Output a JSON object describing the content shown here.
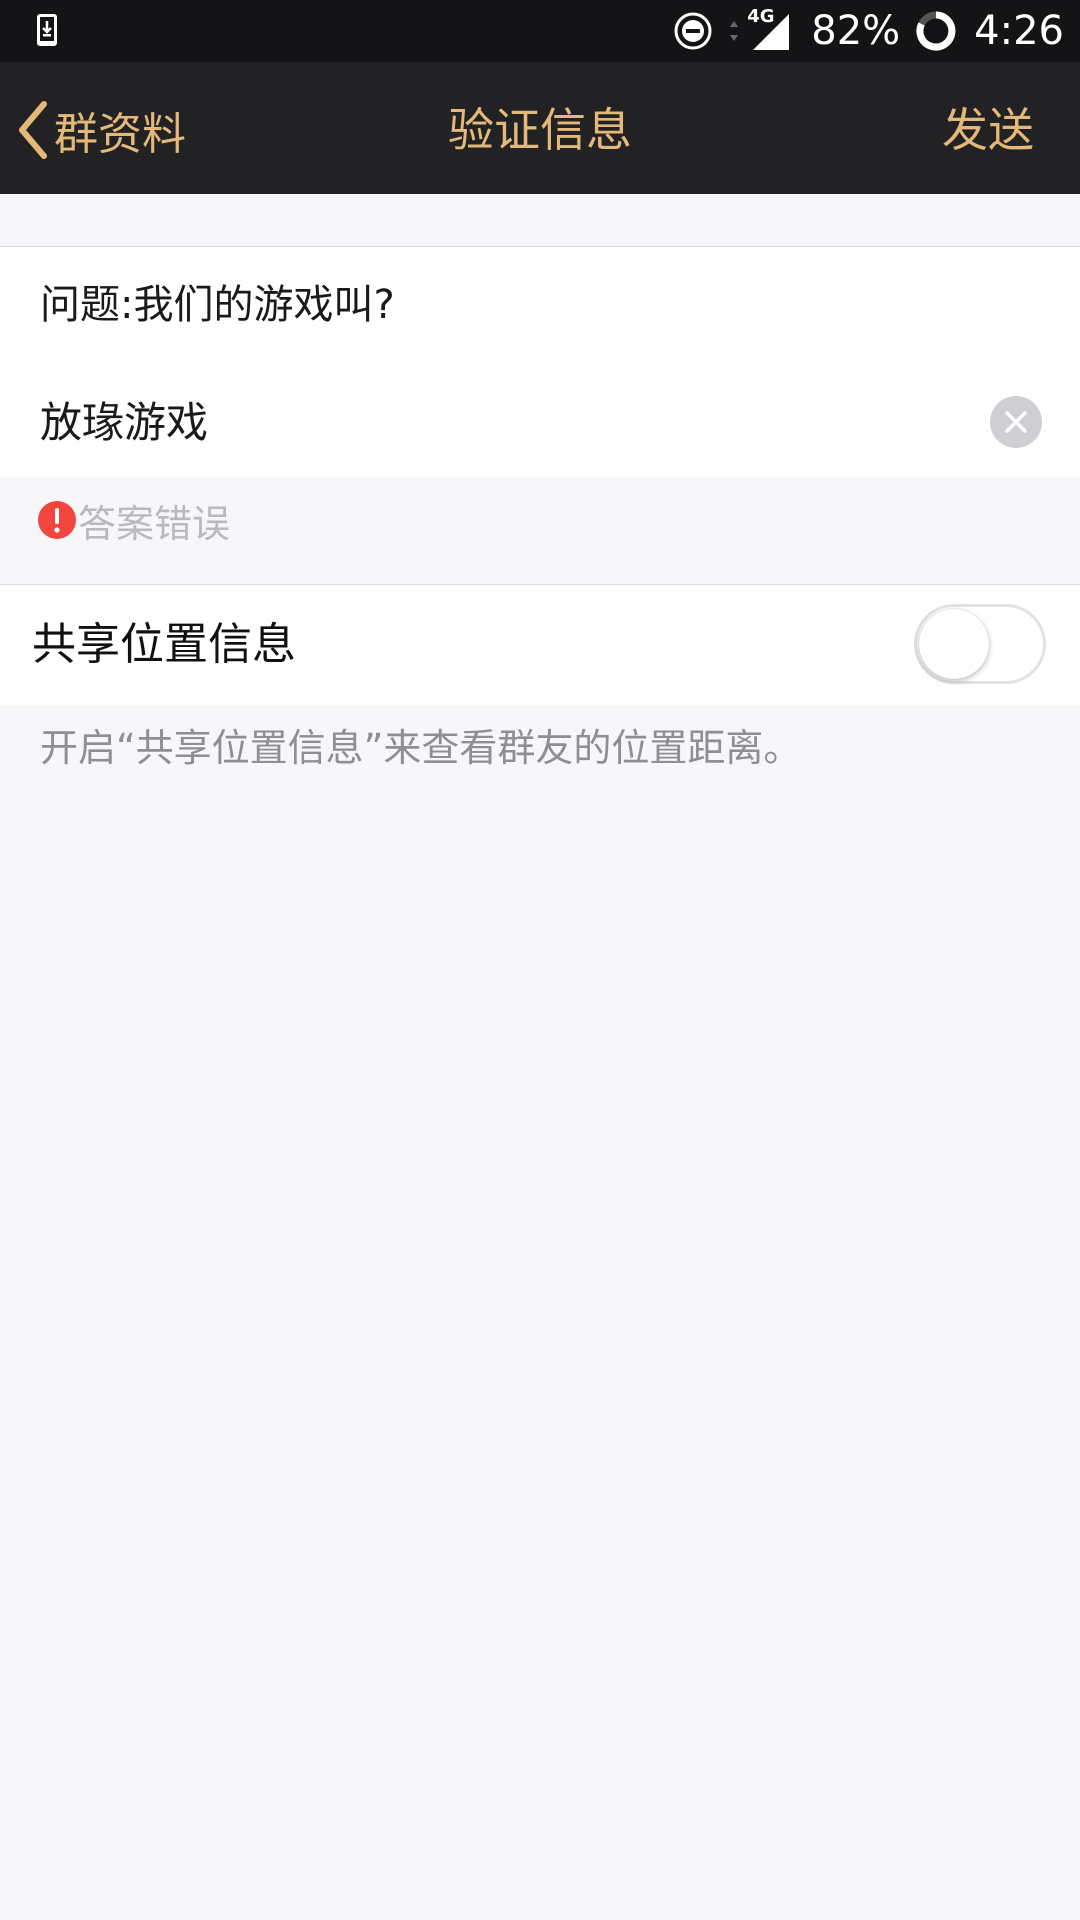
{
  "status_bar": {
    "battery": "82%",
    "time": "4:26",
    "network": "4G",
    "icons": [
      "download-icon",
      "dnd-icon",
      "data-arrows-icon",
      "signal-icon",
      "battery-ring-icon"
    ]
  },
  "nav": {
    "back_label": "群资料",
    "title": "验证信息",
    "send_label": "发送"
  },
  "form": {
    "question": "问题:我们的游戏叫?",
    "answer_value": "放瑑游戏",
    "error_text": "答案错误"
  },
  "share": {
    "label": "共享位置信息",
    "enabled": false,
    "hint": "开启“共享位置信息”来查看群友的位置距离。"
  },
  "colors": {
    "accent": "#e3b878",
    "nav_bg": "#222224",
    "error": "#f1453d"
  }
}
